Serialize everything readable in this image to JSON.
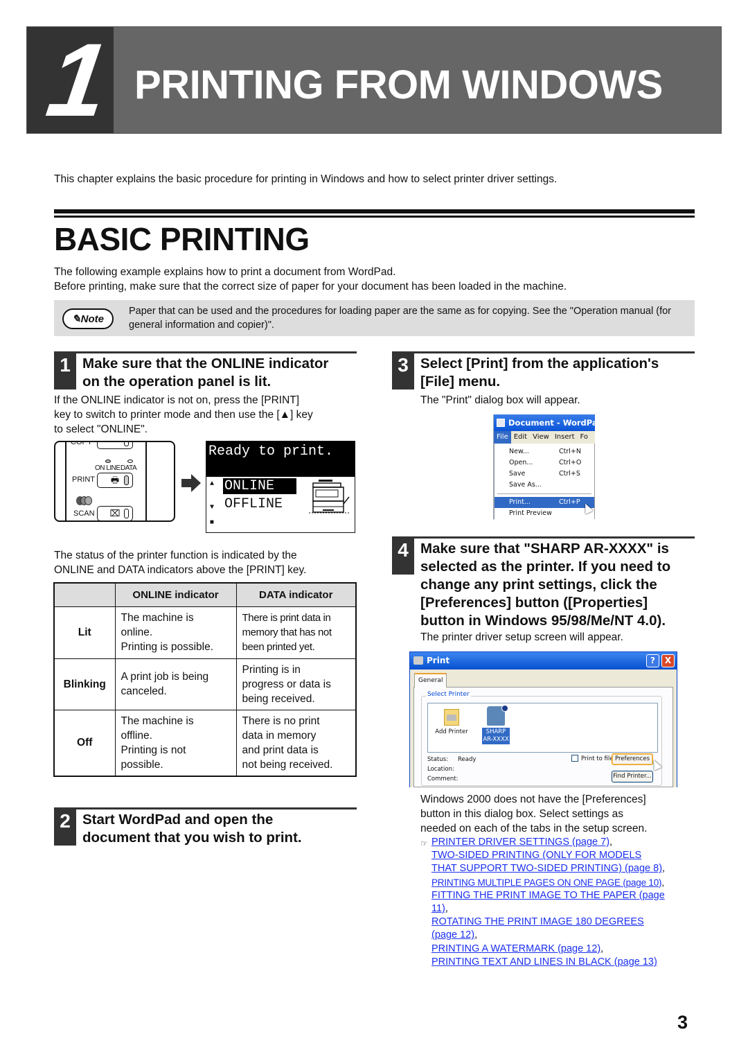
{
  "chapter": {
    "number": "1",
    "title": "PRINTING FROM WINDOWS",
    "intro": "This chapter explains the basic procedure for printing in Windows and how to select printer driver settings."
  },
  "section": {
    "title": "BASIC PRINTING",
    "para1": "The following example explains how to print a document from WordPad.",
    "para2": "Before printing, make sure that the correct size of paper for your document has been loaded in the machine."
  },
  "note": {
    "badge": "Note",
    "text": "Paper that can be used and the procedures for loading paper are the same as for copying. See the \"Operation manual (for general information and copier)\"."
  },
  "steps": [
    {
      "number": "1",
      "title_line1": "Make sure that the ONLINE indicator",
      "title_line2": "on the operation panel is lit.",
      "body_line1": "If the ONLINE indicator is not on, press the [PRINT]",
      "body_line2": "key to switch to printer mode and then use the [▲] key",
      "body_line3": "to select \"ONLINE\"."
    },
    {
      "number": "2",
      "title_line1": "Start WordPad and open the",
      "title_line2": "document that you wish to print."
    },
    {
      "number": "3",
      "title_line1": "Select [Print] from the application's",
      "title_line2": "[File] menu.",
      "body": "The \"Print\" dialog box will appear."
    },
    {
      "number": "4",
      "title_lines": [
        "Make sure that \"SHARP AR-XXXX\" is",
        "selected as the printer. If you need to",
        "change any print settings, click the",
        "[Preferences] button ([Properties]",
        "button in Windows 95/98/Me/NT 4.0)."
      ],
      "body": "The printer driver setup screen will appear."
    }
  ],
  "panel": {
    "copy_label": "COPY",
    "online_led": "ON LINE",
    "data_led": "DATA",
    "print_label": "PRINT",
    "scan_label": "SCAN"
  },
  "lcd": {
    "message": "Ready to print.",
    "option_selected": "ONLINE",
    "option_other": "OFFLINE"
  },
  "status_text": {
    "line1": "The status of the printer function is indicated by the",
    "line2": "ONLINE and DATA indicators above the [PRINT] key."
  },
  "indicator_table": {
    "headers": [
      "",
      "ONLINE indicator",
      "DATA indicator"
    ],
    "rows": [
      {
        "state": "Lit",
        "online": "The machine is\nonline.\nPrinting is possible.",
        "data": "There is print data in\nmemory that has not\nbeen printed yet."
      },
      {
        "state": "Blinking",
        "online": "A print job is being\ncanceled.",
        "data": "Printing is in\nprogress or data is\nbeing received."
      },
      {
        "state": "Off",
        "online": "The machine is\noffline.\nPrinting is not\npossible.",
        "data": "There is no print\ndata in memory\nand print data is\nnot being received."
      }
    ]
  },
  "wordpad": {
    "title": "Document - WordPad",
    "menubar": [
      "File",
      "Edit",
      "View",
      "Insert",
      "Fo"
    ],
    "items": [
      {
        "label": "New...",
        "shortcut": "Ctrl+N"
      },
      {
        "label": "Open...",
        "shortcut": "Ctrl+O"
      },
      {
        "label": "Save",
        "shortcut": "Ctrl+S"
      },
      {
        "label": "Save As...",
        "shortcut": ""
      },
      {
        "label": "Print...",
        "shortcut": "Ctrl+P"
      },
      {
        "label": "Print Preview",
        "shortcut": ""
      }
    ]
  },
  "print_dialog": {
    "title": "Print",
    "help": "?",
    "close": "X",
    "tab": "General",
    "group_label": "Select Printer",
    "add_printer": "Add Printer",
    "printer_line1": "SHARP",
    "printer_line2": "AR-XXXX",
    "status_label": "Status:",
    "status_value": "Ready",
    "location_label": "Location:",
    "comment_label": "Comment:",
    "print_to_file": "Print to file",
    "preferences_button": "Preferences",
    "find_printer_button": "Find Printer..."
  },
  "win2k_note": {
    "line1": "Windows 2000 does not have the [Preferences]",
    "line2": "button in this dialog box. Select settings as",
    "line3": "needed on each of the tabs in the setup screen."
  },
  "references": {
    "icon": "☞",
    "link1": "PRINTER DRIVER SETTINGS (page 7)",
    "link2a": "TWO-SIDED PRINTING (ONLY FOR MODELS ",
    "link2b": "THAT SUPPORT TWO-SIDED PRINTING) (page 8)",
    "link3": "PRINTING MULTIPLE PAGES ON ONE PAGE (page 10)",
    "link4a": "FITTING THE PRINT IMAGE TO THE PAPER (page ",
    "link4b": "11)",
    "link5a": "ROTATING THE PRINT IMAGE 180 DEGREES ",
    "link5b": "(page 12)",
    "link6": "PRINTING A WATERMARK (page 12)",
    "link7": "PRINTING TEXT AND LINES IN BLACK (page 13)",
    "comma": ","
  },
  "page_number": "3"
}
